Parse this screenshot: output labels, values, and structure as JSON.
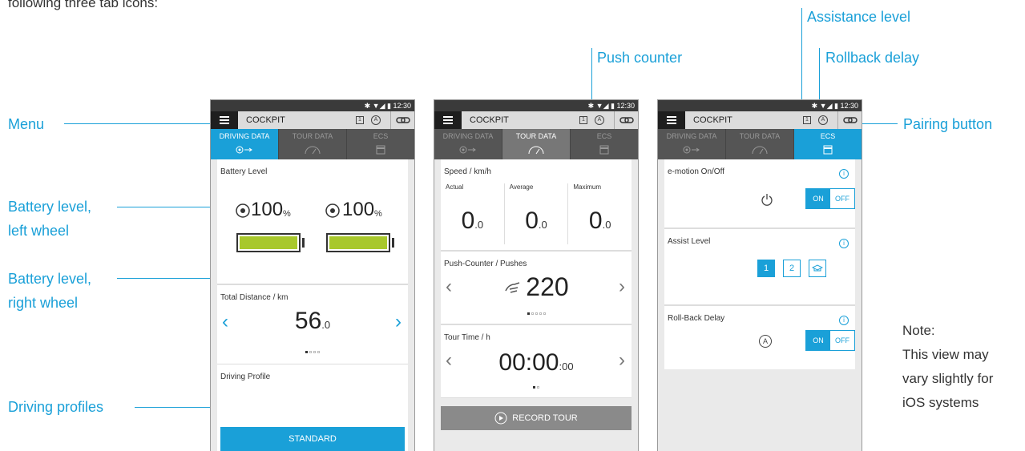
{
  "page": {
    "intro_text": "following three tab icons:",
    "note_lines": [
      "Note:",
      "This view may",
      "vary slightly for",
      "iOS systems"
    ]
  },
  "callouts": {
    "menu": "Menu",
    "battery_left": [
      "Battery level,",
      "left wheel"
    ],
    "battery_right": [
      "Battery level,",
      "right wheel"
    ],
    "driving_profiles": "Driving profiles",
    "push_counter": "Push counter",
    "assistance_level": "Assistance level",
    "rollback_delay": "Rollback delay",
    "pairing_button": "Pairing button"
  },
  "common": {
    "status_time": "12:30",
    "app_title": "COCKPIT",
    "icon_1": "1",
    "icon_a": "A",
    "tabs": [
      "DRIVING DATA",
      "TOUR DATA",
      "ECS"
    ]
  },
  "screen1": {
    "battery_label": "Battery Level",
    "left": {
      "side": "L",
      "value": "100",
      "unit": "%",
      "level": 1.0
    },
    "right": {
      "side": "R",
      "value": "100",
      "unit": "%",
      "level": 1.0
    },
    "distance_label": "Total Distance / km",
    "distance_int": "56",
    "distance_dec": ".0",
    "profile_label": "Driving Profile",
    "profile_button": "STANDARD"
  },
  "screen2": {
    "speed_label": "Speed / km/h",
    "cols": [
      {
        "label": "Actual",
        "int": "0",
        "dec": ".0"
      },
      {
        "label": "Average",
        "int": "0",
        "dec": ".0"
      },
      {
        "label": "Maximum",
        "int": "0",
        "dec": ".0"
      }
    ],
    "push_label": "Push-Counter / Pushes",
    "push_value": "220",
    "tour_label": "Tour Time / h",
    "tour_main": "00:00",
    "tour_sub": ":00",
    "record_button": "RECORD TOUR"
  },
  "screen3": {
    "emotion_label": "e-motion On/Off",
    "assist_label": "Assist Level",
    "assist_levels": [
      "1",
      "2"
    ],
    "rollback_label": "Roll-Back Delay",
    "on": "ON",
    "off": "OFF",
    "info": "i"
  },
  "colors": {
    "accent": "#1aa0d8",
    "battery": "#a8c82c",
    "dark": "#1e1e1e"
  }
}
